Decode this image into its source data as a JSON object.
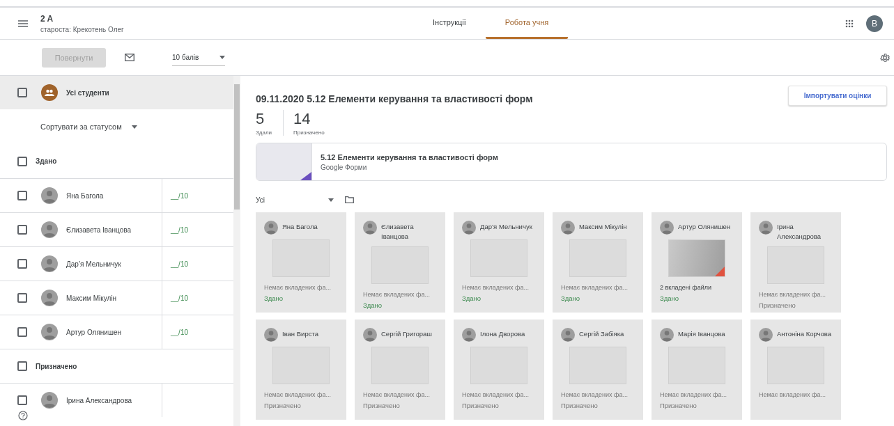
{
  "header": {
    "title": "2 A",
    "subtitle": "староста: Крекотень Олег",
    "avatar": "B"
  },
  "tabs": [
    {
      "label": "Інструкції",
      "selected": false
    },
    {
      "label": "Робота учня",
      "selected": true
    }
  ],
  "toolbar": {
    "return_button": "Повернути",
    "return_disabled": true,
    "points": "10 балів"
  },
  "roster": {
    "all_label": "Усі студенти",
    "all_checked": false,
    "sort_label": "Сортувати за статусом",
    "rows": [
      {
        "kind": "group",
        "label": "Здано",
        "checked": false
      },
      {
        "kind": "student",
        "name": "Яна Багола",
        "grade": "__/10",
        "checked": false
      },
      {
        "kind": "student",
        "name": "Єлизавета Іванцова",
        "grade": "__/10",
        "checked": false
      },
      {
        "kind": "student",
        "name": "Дар’я Мельничук",
        "grade": "__/10",
        "checked": false
      },
      {
        "kind": "student",
        "name": "Максим Мікулін",
        "grade": "__/10",
        "checked": false
      },
      {
        "kind": "student",
        "name": "Артур Олянишен",
        "grade": "__/10",
        "checked": false
      },
      {
        "kind": "group",
        "label": "Призначено",
        "checked": false
      },
      {
        "kind": "student",
        "name": "Ірина Александрова",
        "checked": false
      }
    ]
  },
  "assignment": {
    "title": "09.11.2020 5.12 Елементи керування та властивості форм",
    "import_button": "Імпортувати оцінки",
    "stats": [
      {
        "value": "5",
        "label": "Здали"
      },
      {
        "value": "14",
        "label": "Призначено"
      }
    ],
    "attachment": {
      "title": "5.12 Елементи керування та властивості форм",
      "type": "Google Форми"
    },
    "filter": "Усі",
    "cards": [
      {
        "name": "Яна Багола",
        "files": "Немає вкладених фа...",
        "has_files": false,
        "status": "Здано",
        "kind": "submitted"
      },
      {
        "name": "Єлизавета Іванцова",
        "files": "Немає вкладених фа...",
        "has_files": false,
        "status": "Здано",
        "kind": "submitted"
      },
      {
        "name": "Дар’я Мельничук",
        "files": "Немає вкладених фа...",
        "has_files": false,
        "status": "Здано",
        "kind": "submitted"
      },
      {
        "name": "Максим Мікулін",
        "files": "Немає вкладених фа...",
        "has_files": false,
        "status": "Здано",
        "kind": "submitted"
      },
      {
        "name": "Артур Олянишен",
        "files": "2 вкладені файли",
        "has_files": true,
        "status": "Здано",
        "kind": "submitted"
      },
      {
        "name": "Ірина Александрова",
        "files": "Немає вкладених фа...",
        "has_files": false,
        "status": "Призначено",
        "kind": "assigned"
      },
      {
        "name": "Іван Вирста",
        "files": "Немає вкладених фа...",
        "has_files": false,
        "status": "Призначено",
        "kind": "assigned"
      },
      {
        "name": "Сергій Григораш",
        "files": "Немає вкладених фа...",
        "has_files": false,
        "status": "Призначено",
        "kind": "assigned"
      },
      {
        "name": "Ілона Дворова",
        "files": "Немає вкладених фа...",
        "has_files": false,
        "status": "Призначено",
        "kind": "assigned"
      },
      {
        "name": "Сергій Забіяка",
        "files": "Немає вкладених фа...",
        "has_files": false,
        "status": "Призначено",
        "kind": "assigned"
      },
      {
        "name": "Марія Іванцова",
        "files": "Немає вкладених фа...",
        "has_files": false,
        "status": "Призначено",
        "kind": "assigned"
      },
      {
        "name": "Антоніна Корчова",
        "files": "Немає вкладених фа...",
        "has_files": false
      }
    ]
  }
}
